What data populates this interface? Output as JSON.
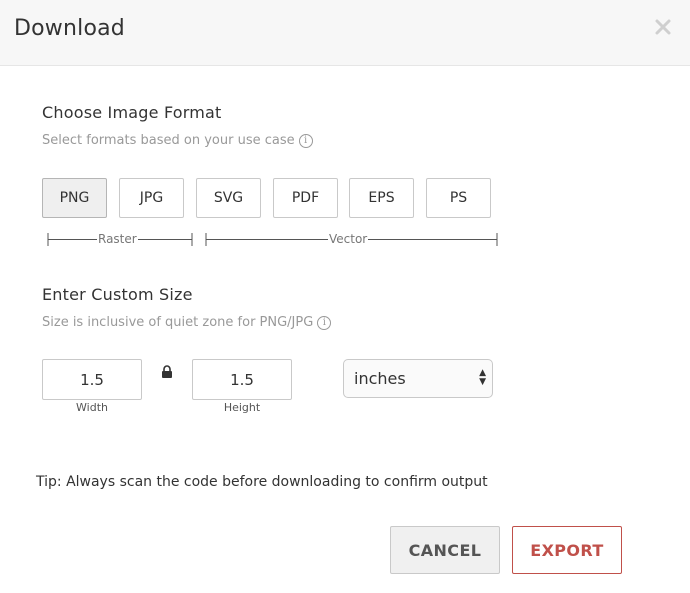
{
  "dialog": {
    "title": "Download",
    "close_icon": "close-icon"
  },
  "format_section": {
    "title": "Choose Image Format",
    "subtitle": "Select formats based on your use case",
    "info_icon": "info-icon",
    "formats": [
      "PNG",
      "JPG",
      "SVG",
      "PDF",
      "EPS",
      "PS"
    ],
    "selected": "PNG",
    "groups": {
      "raster": "Raster",
      "vector": "Vector"
    }
  },
  "size_section": {
    "title": "Enter Custom Size",
    "subtitle": "Size is inclusive of quiet zone for PNG/JPG",
    "info_icon": "info-icon",
    "width_value": "1.5",
    "width_label": "Width",
    "lock_icon": "lock-icon",
    "height_value": "1.5",
    "height_label": "Height",
    "unit": "inches"
  },
  "tip": "Tip: Always scan the code before downloading to confirm output",
  "actions": {
    "cancel": "CANCEL",
    "export": "EXPORT"
  },
  "colors": {
    "accent": "#c0504a",
    "header_bg": "#f7f7f7",
    "selected_bg": "#efefef"
  }
}
